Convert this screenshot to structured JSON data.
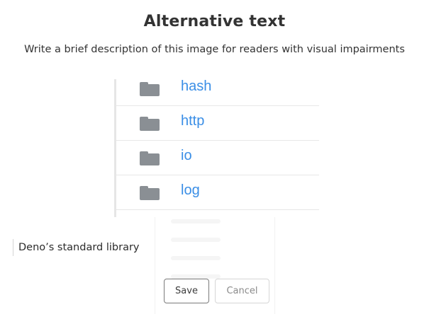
{
  "dialog": {
    "title": "Alternative text",
    "subtitle": "Write a brief description of this image for readers with visual impairments"
  },
  "preview": {
    "rows": [
      {
        "name": "hash",
        "icon": "folder-icon"
      },
      {
        "name": "http",
        "icon": "folder-icon"
      },
      {
        "name": "io",
        "icon": "folder-icon"
      },
      {
        "name": "log",
        "icon": "folder-icon"
      }
    ]
  },
  "caption": {
    "value": "Deno’s standard library"
  },
  "actions": {
    "save_label": "Save",
    "cancel_label": "Cancel"
  },
  "colors": {
    "link": "#3a8ee6",
    "folder": "#8a8f94",
    "text": "#333333"
  }
}
